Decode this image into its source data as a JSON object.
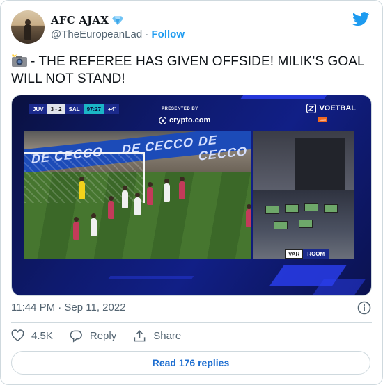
{
  "author": {
    "display_name": "AFC AJAX",
    "handle": "@TheEuropeanLad",
    "separator": "·",
    "follow_label": "Follow",
    "verified_badge_icon": "blue-diamond-icon"
  },
  "tweet": {
    "emoji_icon": "camera-flash-icon",
    "text": "- THE REFEREE HAS GIVEN OFFSIDE! MILIK'S GOAL WILL NOT STAND!",
    "timestamp": "11:44 PM · Sep 11, 2022"
  },
  "media": {
    "scorebug": {
      "home": "JUV",
      "score": "3 - 2",
      "away": "SAL",
      "clock": "97:27",
      "added": "+4'"
    },
    "sponsor": {
      "presented_by": "PRESENTED BY",
      "name": "crypto.com"
    },
    "broadcaster": {
      "name": "VOETBAL",
      "live": "LIVE"
    },
    "ad_boards": [
      "DE CECCO",
      "DE CECCO",
      "DE CECCO"
    ],
    "var_label": {
      "left": "VAR",
      "right": "ROOM"
    }
  },
  "actions": {
    "likes": "4.5K",
    "reply_label": "Reply",
    "share_label": "Share"
  },
  "footer": {
    "read_replies": "Read 176 replies"
  },
  "colors": {
    "accent": "#1d9bf0",
    "secondary_text": "#536471",
    "border": "#cfd9de"
  }
}
